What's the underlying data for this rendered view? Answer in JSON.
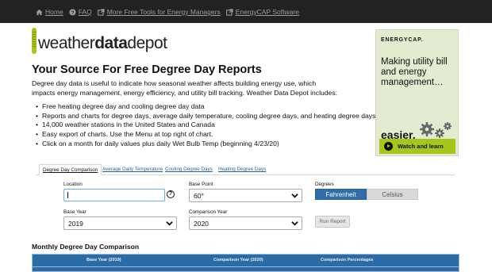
{
  "nav": {
    "items": [
      {
        "label": "Home",
        "icon": "home-icon"
      },
      {
        "label": "FAQ",
        "icon": "question-circle-icon"
      },
      {
        "label": "More Free Tools for Energy Managers",
        "icon": "external-link-icon"
      },
      {
        "label": "EnergyCAP Software",
        "icon": "external-link-icon"
      }
    ]
  },
  "logo": {
    "part1": "weather",
    "part2": "data",
    "part3": "depot",
    "accent": "#a7c61b"
  },
  "headline": "Your Source For Free Degree Day Reports",
  "intro": "Degree day data is useful to indicate how seasonal weather affects building energy use, which impacts energy management, energy efficiency, and utility bill tracking. Weather Data Depot includes:",
  "bullets": [
    "Free heating degree day and cooling degree day data",
    "Reports and charts for degree days, average daily temperature, cooling degree days, and heating degree days.",
    "14,000 weather stations in the United States and Canada",
    "Easy export of charts. Use the Menu at top right of chart.",
    "Click on a month for daily values plus daily Wet Bulb Temp (beginning 4/23/20)"
  ],
  "ad": {
    "brand": "ENERGYCAP.",
    "message": "Making utility bill and energy management…",
    "tagline": "easier.",
    "cta": "Watch and learn",
    "bg": "#e3ecd0"
  },
  "tabs": [
    {
      "label": "Degree Day Comparison",
      "active": true
    },
    {
      "label": "Average Daily Temperature",
      "active": false
    },
    {
      "label": "Cooling Degree Days",
      "active": false
    },
    {
      "label": "Heating Degree Days",
      "active": false
    }
  ],
  "form": {
    "location_label": "Location",
    "location_value": "",
    "help": "?",
    "base_point_label": "Base Point",
    "base_point_value": "60°",
    "degrees_label": "Degrees",
    "fahrenheit": "Fahrenheit",
    "celsius": "Celsius",
    "base_year_label": "Base Year",
    "base_year_value": "2019",
    "comparison_year_label": "Comparison Year",
    "comparison_year_value": "2020",
    "run_report": "Run Report"
  },
  "table": {
    "title": "Monthly Degree Day Comparison",
    "headers": [
      "Base Year (2019)",
      "Comparison Year (2020)",
      "Comparison Percentages"
    ],
    "header_bg": "#2b6ca6"
  }
}
